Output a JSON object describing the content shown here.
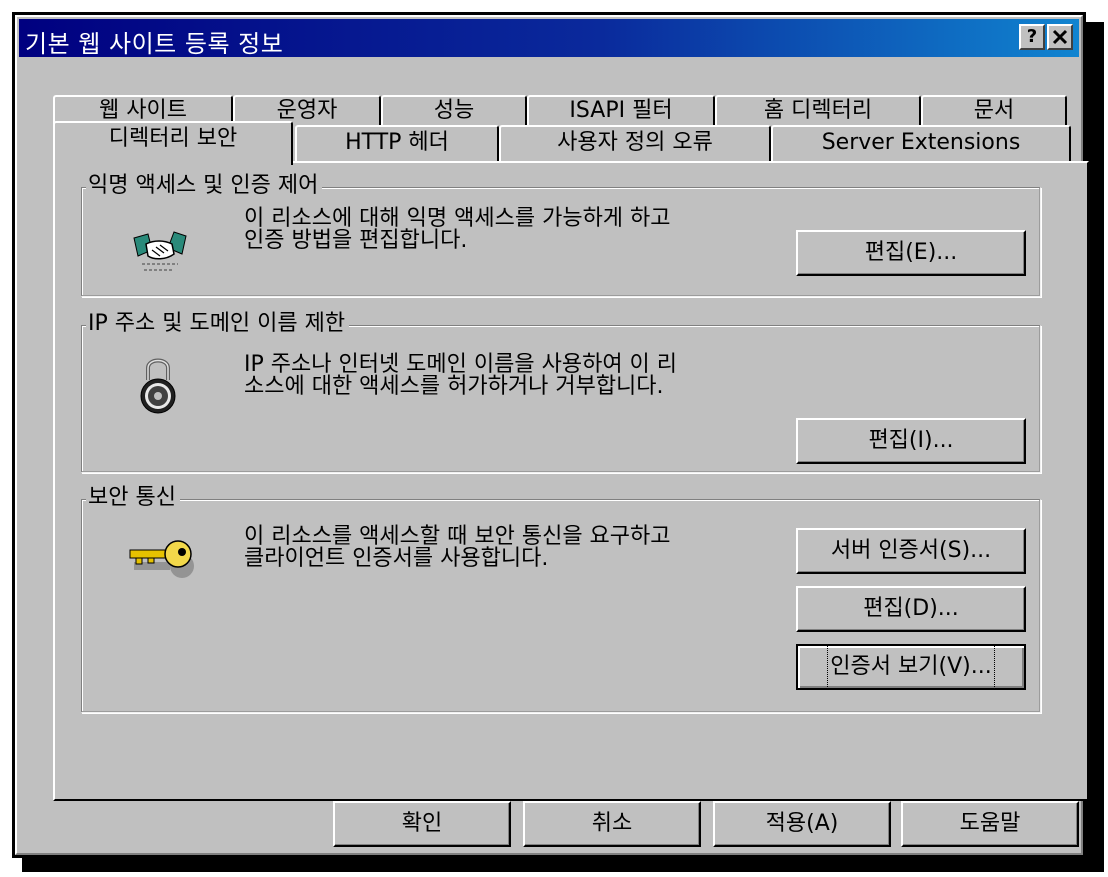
{
  "window": {
    "title": "기본 웹 사이트 등록 정보",
    "help_button": "?",
    "close_button": "✕"
  },
  "tabs_back": [
    "웹 사이트",
    "운영자",
    "성능",
    "ISAPI 필터",
    "홈 디렉터리",
    "문서"
  ],
  "tabs_front": [
    "디렉터리 보안",
    "HTTP 헤더",
    "사용자 정의 오류",
    "Server Extensions"
  ],
  "selected_tab": "디렉터리 보안",
  "groups": {
    "anonymous": {
      "title": "익명 액세스 및 인증 제어",
      "description": "이 리소스에 대해 익명 액세스를 가능하게 하고\n인증 방법을 편집합니다.",
      "edit_button": "편집(E)...",
      "icon": "handshake-icon"
    },
    "ip": {
      "title": "IP 주소 및 도메인 이름 제한",
      "description": "IP 주소나 인터넷 도메인 이름을 사용하여 이 리\n소스에 대한 액세스를 허가하거나 거부합니다.",
      "edit_button": "편집(I)...",
      "icon": "padlock-icon"
    },
    "secure": {
      "title": "보안 통신",
      "description": "이 리소스를 액세스할 때 보안 통신을 요구하고\n클라이언트 인증서를 사용합니다.",
      "server_cert_button": "서버 인증서(S)...",
      "edit_button": "편집(D)...",
      "view_cert_button": "인증서 보기(V)...",
      "icon": "key-icon"
    }
  },
  "footer": {
    "ok": "확인",
    "cancel": "취소",
    "apply": "적용(A)",
    "help": "도움말"
  },
  "colors": {
    "face": "#c0c0c0",
    "titlebar_start": "#000080",
    "titlebar_end": "#1084d0"
  }
}
